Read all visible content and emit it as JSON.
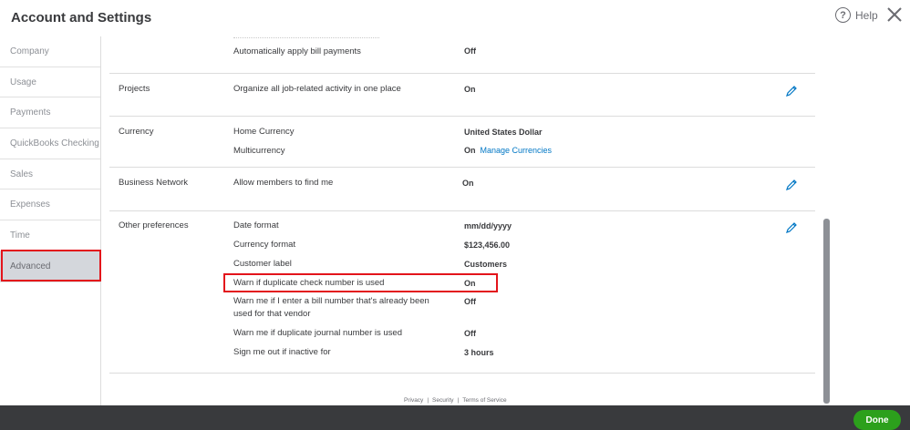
{
  "header": {
    "title": "Account and Settings",
    "help_label": "Help",
    "help_icon": "?"
  },
  "sidebar": {
    "items": [
      {
        "label": "Company"
      },
      {
        "label": "Usage"
      },
      {
        "label": "Payments"
      },
      {
        "label": "QuickBooks Checking"
      },
      {
        "label": "Sales"
      },
      {
        "label": "Expenses"
      },
      {
        "label": "Time"
      },
      {
        "label": "Advanced",
        "active": true
      }
    ]
  },
  "sections": {
    "bills": {
      "row": {
        "label": "Automatically apply bill payments",
        "value": "Off"
      }
    },
    "projects": {
      "title": "Projects",
      "row": {
        "label": "Organize all job-related activity in one place",
        "value": "On"
      }
    },
    "currency": {
      "title": "Currency",
      "rows": [
        {
          "label": "Home Currency",
          "value": "United States Dollar"
        },
        {
          "label": "Multicurrency",
          "value": "On",
          "link": "Manage Currencies"
        }
      ]
    },
    "business_network": {
      "title": "Business Network",
      "row": {
        "label": "Allow members to find me",
        "value": "On"
      }
    },
    "other": {
      "title": "Other preferences",
      "rows": [
        {
          "label": "Date format",
          "value": "mm/dd/yyyy"
        },
        {
          "label": "Currency format",
          "value": "$123,456.00"
        },
        {
          "label": "Customer label",
          "value": "Customers"
        },
        {
          "label": "Warn if duplicate check number is used",
          "value": "On"
        },
        {
          "label": "Warn me if I enter a bill number that's already been used for that vendor",
          "value": "Off"
        },
        {
          "label": "Warn me if duplicate journal number is used",
          "value": "Off"
        },
        {
          "label": "Sign me out if inactive for",
          "value": "3 hours"
        }
      ]
    }
  },
  "footer": {
    "privacy": "Privacy",
    "security": "Security",
    "terms": "Terms of Service",
    "separator": "|"
  },
  "done_label": "Done",
  "colors": {
    "accent_green": "#2ca01c",
    "link_blue": "#0077c5",
    "highlight_red": "#e3141b",
    "bottom_bar": "#393a3d"
  }
}
